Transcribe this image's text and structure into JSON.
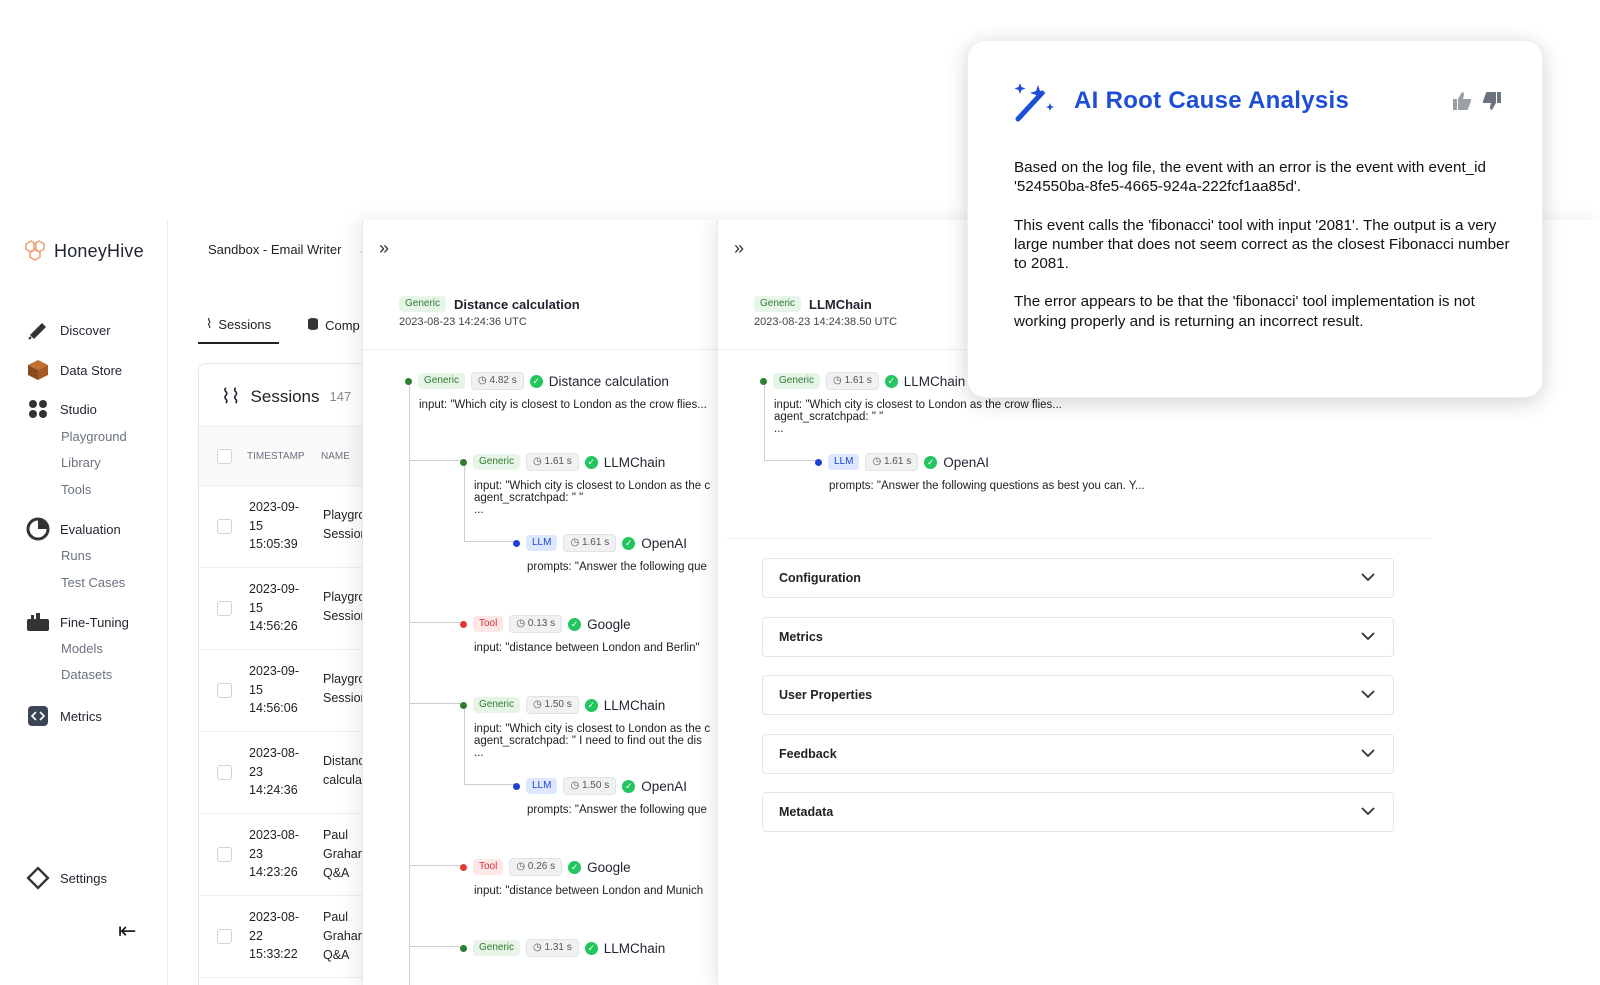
{
  "app": {
    "name": "HoneyHive"
  },
  "sidebar": {
    "items": [
      {
        "label": "Discover",
        "icon": "telescope-icon"
      },
      {
        "label": "Data Store",
        "icon": "box-icon"
      },
      {
        "label": "Studio",
        "icon": "grid-dots-icon",
        "children": [
          "Playground",
          "Library",
          "Tools"
        ]
      },
      {
        "label": "Evaluation",
        "icon": "chart-pie-icon",
        "children": [
          "Runs",
          "Test Cases"
        ]
      },
      {
        "label": "Fine-Tuning",
        "icon": "tuning-icon",
        "children": [
          "Models",
          "Datasets"
        ]
      },
      {
        "label": "Metrics",
        "icon": "code-icon"
      },
      {
        "label": "Settings",
        "icon": "settings-icon"
      }
    ],
    "collapse_icon": "collapse-left-icon"
  },
  "project": {
    "name": "Sandbox - Email Writer"
  },
  "sessions": {
    "tabs": [
      "Sessions",
      "Comp"
    ],
    "title": "Sessions",
    "count": "147",
    "columns": [
      "TIMESTAMP",
      "NAME"
    ],
    "rows": [
      {
        "ts": [
          "2023-09-",
          "15",
          "15:05:39"
        ],
        "name": [
          "Playgro",
          "Session"
        ]
      },
      {
        "ts": [
          "2023-09-",
          "15",
          "14:56:26"
        ],
        "name": [
          "Playgro",
          "Session"
        ]
      },
      {
        "ts": [
          "2023-09-",
          "15",
          "14:56:06"
        ],
        "name": [
          "Playgro",
          "Session"
        ]
      },
      {
        "ts": [
          "2023-08-",
          "23",
          "14:24:36"
        ],
        "name": [
          "Distanc",
          "calculat"
        ]
      },
      {
        "ts": [
          "2023-08-",
          "23",
          "14:23:26"
        ],
        "name": [
          "Paul",
          "Grahan",
          "Q&A"
        ]
      },
      {
        "ts": [
          "2023-08-",
          "22",
          "15:33:22"
        ],
        "name": [
          "Paul",
          "Grahan",
          "Q&A"
        ]
      }
    ]
  },
  "trace1": {
    "header": {
      "type": "Generic",
      "name": "Distance calculation",
      "time": "2023-08-23 14:24:36 UTC"
    },
    "nodes": [
      {
        "type": "Generic",
        "dur": "4.82 s",
        "name": "Distance calculation",
        "io": [
          "input: \"Which city is closest to London as the crow flies..."
        ]
      },
      {
        "type": "Generic",
        "dur": "1.61 s",
        "name": "LLMChain",
        "io": [
          "input: \"Which city is closest to London as the c",
          "agent_scratchpad: \" \"",
          "..."
        ]
      },
      {
        "type": "LLM",
        "dur": "1.61 s",
        "name": "OpenAI",
        "io": [
          "prompts: \"Answer the following que"
        ]
      },
      {
        "type": "Tool",
        "dur": "0.13 s",
        "name": "Google",
        "io": [
          "input: \"distance between London and Berlin\""
        ]
      },
      {
        "type": "Generic",
        "dur": "1.50 s",
        "name": "LLMChain",
        "io": [
          "input: \"Which city is closest to London as the c",
          "agent_scratchpad: \" I need to find out the dis",
          "..."
        ]
      },
      {
        "type": "LLM",
        "dur": "1.50 s",
        "name": "OpenAI",
        "io": [
          "prompts: \"Answer the following que"
        ]
      },
      {
        "type": "Tool",
        "dur": "0.26 s",
        "name": "Google",
        "io": [
          "input: \"distance between London and Munich"
        ]
      },
      {
        "type": "Generic",
        "dur": "1.31 s",
        "name": "LLMChain",
        "io": []
      }
    ]
  },
  "trace2": {
    "header": {
      "type": "Generic",
      "name": "LLMChain",
      "time": "2023-08-23 14:24:38.50 UTC"
    },
    "nodes": [
      {
        "type": "Generic",
        "dur": "1.61 s",
        "name": "LLMChain",
        "io": [
          "input: \"Which city is closest to London as the crow flies...",
          "agent_scratchpad: \" \"",
          "..."
        ]
      },
      {
        "type": "LLM",
        "dur": "1.61 s",
        "name": "OpenAI",
        "io": [
          "prompts: \"Answer the following questions as best you can. Y..."
        ]
      }
    ],
    "accordions": [
      "Configuration",
      "Metrics",
      "User Properties",
      "Feedback",
      "Metadata"
    ]
  },
  "rca": {
    "title": "AI Root Cause Analysis",
    "paragraphs": [
      "Based on the log file, the event with an error is the event with event_id '524550ba-8fe5-4665-924a-222fcf1aa85d'.",
      "This event calls the 'fibonacci' tool with input '2081'. The output is a very large number that does not seem correct as the closest Fibonacci number to 2081.",
      "The error appears to be that the 'fibonacci' tool implementation is not working properly and is returning an incorrect result."
    ]
  },
  "colors": {
    "accent": "#1d4ed8",
    "generic": "#2e7d32",
    "tool": "#d32f2f",
    "llm": "#2447c9",
    "success": "#22c55e"
  }
}
